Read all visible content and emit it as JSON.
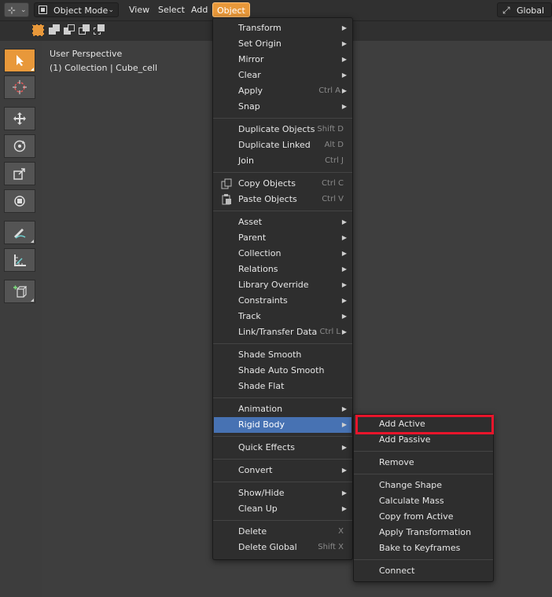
{
  "header": {
    "mode": "Object Mode",
    "menus": [
      "View",
      "Select",
      "Add"
    ],
    "active_menu": "Object",
    "orientation": "Global"
  },
  "viewport": {
    "perspective": "User Perspective",
    "collection": "(1) Collection | Cube_cell"
  },
  "object_menu": {
    "items": [
      {
        "label": "Transform",
        "shortcut": "",
        "submenu": true
      },
      {
        "label": "Set Origin",
        "shortcut": "",
        "submenu": true
      },
      {
        "label": "Mirror",
        "shortcut": "",
        "submenu": true
      },
      {
        "label": "Clear",
        "shortcut": "",
        "submenu": true
      },
      {
        "label": "Apply",
        "shortcut": "Ctrl A",
        "submenu": true
      },
      {
        "label": "Snap",
        "shortcut": "",
        "submenu": true
      },
      {
        "label": "Duplicate Objects",
        "shortcut": "Shift D",
        "submenu": false
      },
      {
        "label": "Duplicate Linked",
        "shortcut": "Alt D",
        "submenu": false
      },
      {
        "label": "Join",
        "shortcut": "Ctrl J",
        "submenu": false
      },
      {
        "label": "Copy Objects",
        "shortcut": "Ctrl C",
        "submenu": false
      },
      {
        "label": "Paste Objects",
        "shortcut": "Ctrl V",
        "submenu": false
      },
      {
        "label": "Asset",
        "shortcut": "",
        "submenu": true
      },
      {
        "label": "Parent",
        "shortcut": "",
        "submenu": true
      },
      {
        "label": "Collection",
        "shortcut": "",
        "submenu": true
      },
      {
        "label": "Relations",
        "shortcut": "",
        "submenu": true
      },
      {
        "label": "Library Override",
        "shortcut": "",
        "submenu": true
      },
      {
        "label": "Constraints",
        "shortcut": "",
        "submenu": true
      },
      {
        "label": "Track",
        "shortcut": "",
        "submenu": true
      },
      {
        "label": "Link/Transfer Data",
        "shortcut": "Ctrl L",
        "submenu": true
      },
      {
        "label": "Shade Smooth",
        "shortcut": "",
        "submenu": false
      },
      {
        "label": "Shade Auto Smooth",
        "shortcut": "",
        "submenu": false
      },
      {
        "label": "Shade Flat",
        "shortcut": "",
        "submenu": false
      },
      {
        "label": "Animation",
        "shortcut": "",
        "submenu": true
      },
      {
        "label": "Rigid Body",
        "shortcut": "",
        "submenu": true
      },
      {
        "label": "Quick Effects",
        "shortcut": "",
        "submenu": true
      },
      {
        "label": "Convert",
        "shortcut": "",
        "submenu": true
      },
      {
        "label": "Show/Hide",
        "shortcut": "",
        "submenu": true
      },
      {
        "label": "Clean Up",
        "shortcut": "",
        "submenu": true
      },
      {
        "label": "Delete",
        "shortcut": "X",
        "submenu": false
      },
      {
        "label": "Delete Global",
        "shortcut": "Shift X",
        "submenu": false
      }
    ]
  },
  "rigid_body_menu": {
    "items": [
      {
        "label": "Add Active"
      },
      {
        "label": "Add Passive"
      },
      {
        "label": "Remove"
      },
      {
        "label": "Change Shape"
      },
      {
        "label": "Calculate Mass"
      },
      {
        "label": "Copy from Active"
      },
      {
        "label": "Apply Transformation"
      },
      {
        "label": "Bake to Keyframes"
      },
      {
        "label": "Connect"
      }
    ]
  },
  "colors": {
    "accent": "#e8983a",
    "menu_highlight": "#4772b3",
    "annotation": "#e8152b"
  }
}
